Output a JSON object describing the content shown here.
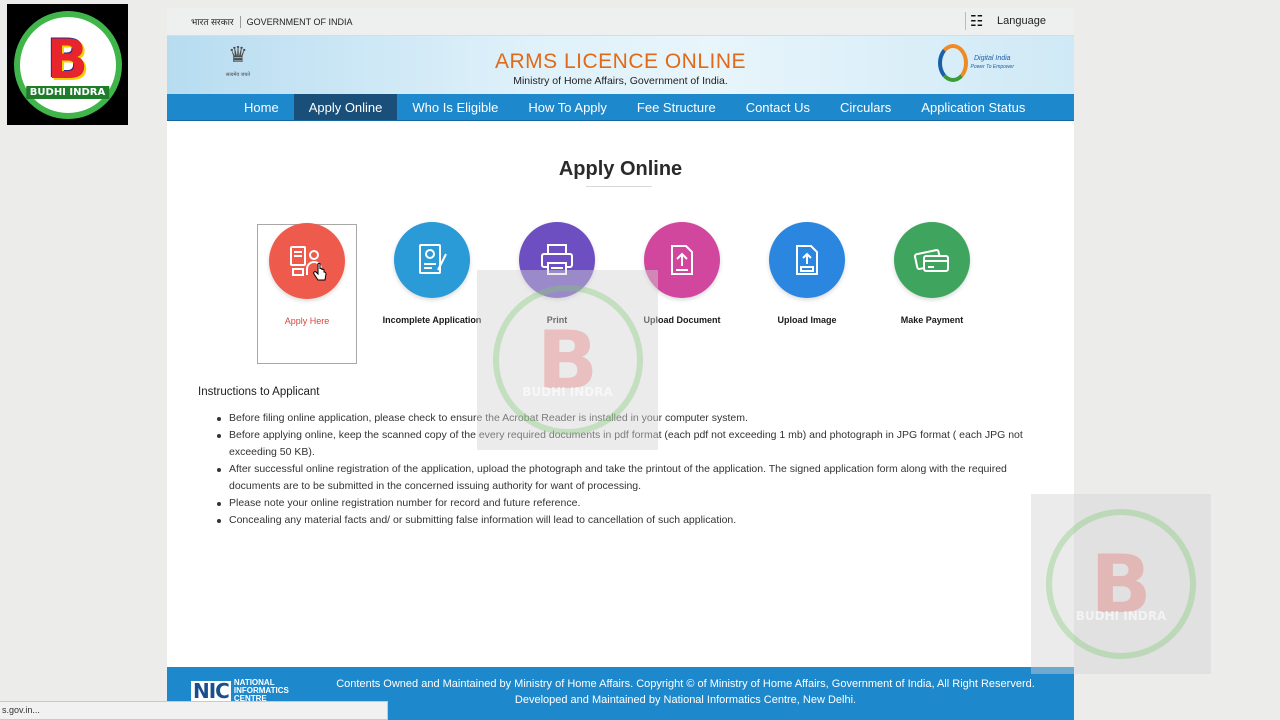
{
  "watermark": {
    "brand_name": "BUDHI INDRA",
    "letter": "B",
    "colors": {
      "ring": "#3fb54a",
      "letter": "#e8242d",
      "band": "#1f7c2b"
    }
  },
  "gov_strip": {
    "hindi": "भारत सरकार",
    "english": "GOVERNMENT OF INDIA",
    "language_label": "Language"
  },
  "header": {
    "title": "ARMS LICENCE ONLINE",
    "subtitle": "Ministry of Home Affairs, Government of India.",
    "emblem_motto": "सत्यमेव जयते",
    "digital_india": "Digital India",
    "digital_india_tagline": "Power To Empower"
  },
  "nav": {
    "items": [
      {
        "label": "Home",
        "active": false
      },
      {
        "label": "Apply Online",
        "active": true
      },
      {
        "label": "Who Is Eligible",
        "active": false
      },
      {
        "label": "How To Apply",
        "active": false
      },
      {
        "label": "Fee Structure",
        "active": false
      },
      {
        "label": "Contact Us",
        "active": false
      },
      {
        "label": "Circulars",
        "active": false
      },
      {
        "label": "Application Status",
        "active": false
      }
    ],
    "color": "#1e88cc",
    "active_color": "#1a4f7a"
  },
  "main": {
    "page_title": "Apply Online",
    "tiles": [
      {
        "label": "Apply Here",
        "icon": "applicant-form-icon",
        "color": "#ee5a4b",
        "selected": true
      },
      {
        "label": "Incomplete Application",
        "icon": "incomplete-form-icon",
        "color": "#2a9bd7",
        "selected": false
      },
      {
        "label": "Print",
        "icon": "printer-icon",
        "color": "#6e4fc2",
        "selected": false
      },
      {
        "label": "Upload Document",
        "icon": "upload-document-icon",
        "color": "#d2479e",
        "selected": false
      },
      {
        "label": "Upload Image",
        "icon": "upload-image-icon",
        "color": "#2b86e0",
        "selected": false
      },
      {
        "label": "Make Payment",
        "icon": "payment-card-icon",
        "color": "#3fa45e",
        "selected": false
      }
    ],
    "instructions_title": "Instructions to Applicant",
    "instructions": [
      "Before filing online application, please check to ensure the Acrobat Reader is installed in your computer system.",
      "Before applying online, keep the scanned copy of the every required documents in pdf format (each pdf not exceeding 1 mb) and photograph in JPG format ( each JPG not exceeding 50 KB).",
      "After successful online registration of the application, upload the photograph and take the printout of the application. The signed application form along with the required documents are to be submitted in the concerned issuing authority for want of processing.",
      "Please note your online registration number for record and future reference.",
      "Concealing any material facts and/ or submitting false information will lead to cancellation of such application."
    ]
  },
  "footer": {
    "nic_mark": "NIC",
    "nic_line1": "NATIONAL",
    "nic_line2": "INFORMATICS",
    "nic_line3": "CENTRE",
    "line1": "Contents Owned and Maintained by Ministry of Home Affairs. Copyright © of Ministry of Home Affairs, Government of India, All Right Reserverd.",
    "line2": "Developed and Maintained by National Informatics Centre, New Delhi."
  },
  "status_bar": {
    "url": "s.gov.in..."
  }
}
